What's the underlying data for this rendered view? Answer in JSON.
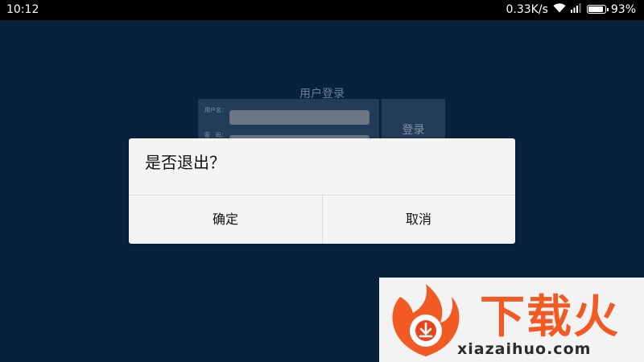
{
  "status_bar": {
    "time": "10:12",
    "network_speed": "0.33K/s",
    "battery_percent_label": "93%",
    "battery_level": 0.93,
    "icons": [
      "wifi-icon",
      "signal-icon",
      "battery-icon"
    ]
  },
  "login_form": {
    "title": "用户登录",
    "username_label": "用户名：",
    "password_label": "密　码：",
    "username_value": "",
    "password_value": "",
    "login_button": "登录"
  },
  "dialog": {
    "message": "是否退出？",
    "confirm_label": "确定",
    "cancel_label": "取消"
  },
  "watermark": {
    "brand_text": "下载火",
    "url_text": "xiazaihuo.com",
    "brand_color": "#f15a22"
  },
  "colors": {
    "background": "#08223d",
    "dialog_background": "#f4f4f4",
    "status_bar": "#000000"
  }
}
